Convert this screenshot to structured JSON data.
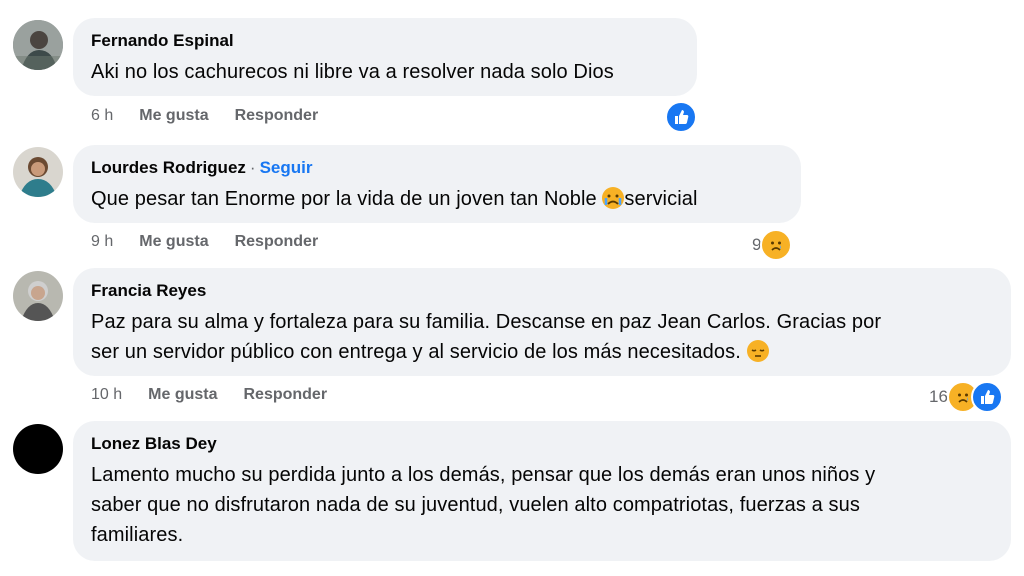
{
  "comments": [
    {
      "author": "Fernando Espinal",
      "text": "Aki no los cachurecos ni libre va a resolver nada solo Dios",
      "time": "6 h",
      "like_label": "Me gusta",
      "reply_label": "Responder",
      "reaction_count": ""
    },
    {
      "author": "Lourdes Rodriguez",
      "follow_label": "Seguir",
      "text_before": "Que pesar tan Enorme por la vida de un joven tan Noble ",
      "text_after": "servicial",
      "time": "9 h",
      "like_label": "Me gusta",
      "reply_label": "Responder",
      "reaction_count": "9"
    },
    {
      "author": "Francia Reyes",
      "text_line1": "Paz para su alma y fortaleza para su familia. Descanse en paz Jean Carlos. Gracias por",
      "text_line2": "ser un servidor público con entrega y al servicio de los más necesitados. ",
      "time": "10 h",
      "like_label": "Me gusta",
      "reply_label": "Responder",
      "reaction_count": "16"
    },
    {
      "author": "Lonez Blas Dey",
      "text_line1": "Lamento mucho su perdida junto a los demás, pensar que los demás eran unos niños y",
      "text_line2": "saber que no disfrutaron nada de su juventud, vuelen alto compatriotas, fuerzas a sus",
      "text_line3": "familiares."
    }
  ],
  "colors": {
    "bubble": "#f0f2f5",
    "link": "#1877f2",
    "muted": "#65676b",
    "emoji": "#f7b125"
  }
}
